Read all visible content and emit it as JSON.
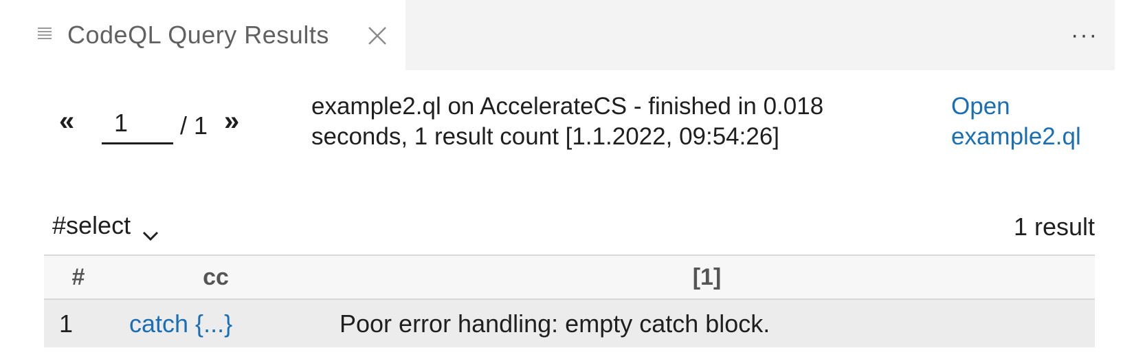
{
  "tab": {
    "icon": "lines-icon",
    "title": "CodeQL Query Results",
    "close_icon": "close-icon"
  },
  "toolbar": {
    "more_icon": "more-icon",
    "more_label": "···"
  },
  "pager": {
    "prev_label": "«",
    "current_page": "1",
    "total_label": "/ 1",
    "next_label": "»"
  },
  "query_info": {
    "text": "example2.ql on AccelerateCS - finished in 0.018 seconds, 1 result count [1.1.2022, 09:54:26]"
  },
  "open_link": {
    "label": "Open example2.ql"
  },
  "result_set": {
    "selected": "#select",
    "count_label": "1 result"
  },
  "table": {
    "columns": [
      "#",
      "cc",
      "[1]"
    ],
    "rows": [
      {
        "num": "1",
        "cc": "catch {...}",
        "message": "Poor error handling: empty catch block."
      }
    ]
  },
  "colors": {
    "link": "#1a6fb4",
    "tabbar_bg": "#f3f3f3",
    "row_bg": "#ececec"
  }
}
